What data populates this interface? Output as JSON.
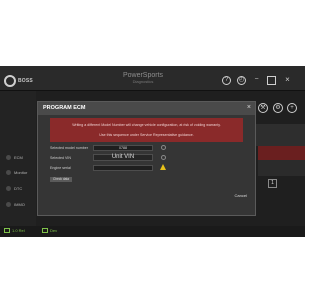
{
  "app": {
    "logo_text": "BOSS",
    "title": "PowerSports",
    "subtitle": "Diagnostics"
  },
  "sidebar": {
    "items": [
      {
        "label": "ECM"
      },
      {
        "label": "Monitor"
      },
      {
        "label": "DTC"
      },
      {
        "label": "IMMO"
      }
    ]
  },
  "bottom_bar": {
    "items": [
      {
        "label": "1.0 Rel"
      },
      {
        "label": "Dev"
      }
    ]
  },
  "background": {
    "box_value": "1"
  },
  "modal": {
    "title": "PROGRAM ECM",
    "close_glyph": "×",
    "warning_line1": "Writing a different Model Number will change vehicle configuration, at risk of voiding warranty.",
    "warning_line2": "Use this sequence under Service Representative guidance.",
    "fields": [
      {
        "label": "Selected model number",
        "value": "0788"
      },
      {
        "label": "Selected VIN",
        "value": "Unit VIN"
      },
      {
        "label": "Engine serial",
        "value": ""
      }
    ],
    "sub_button": "Check data",
    "cancel_label": "Cancel"
  },
  "colors": {
    "warning_bg": "#8a2a2a",
    "accent_green": "#7fc24a",
    "warning_icon": "#e8c21a"
  }
}
